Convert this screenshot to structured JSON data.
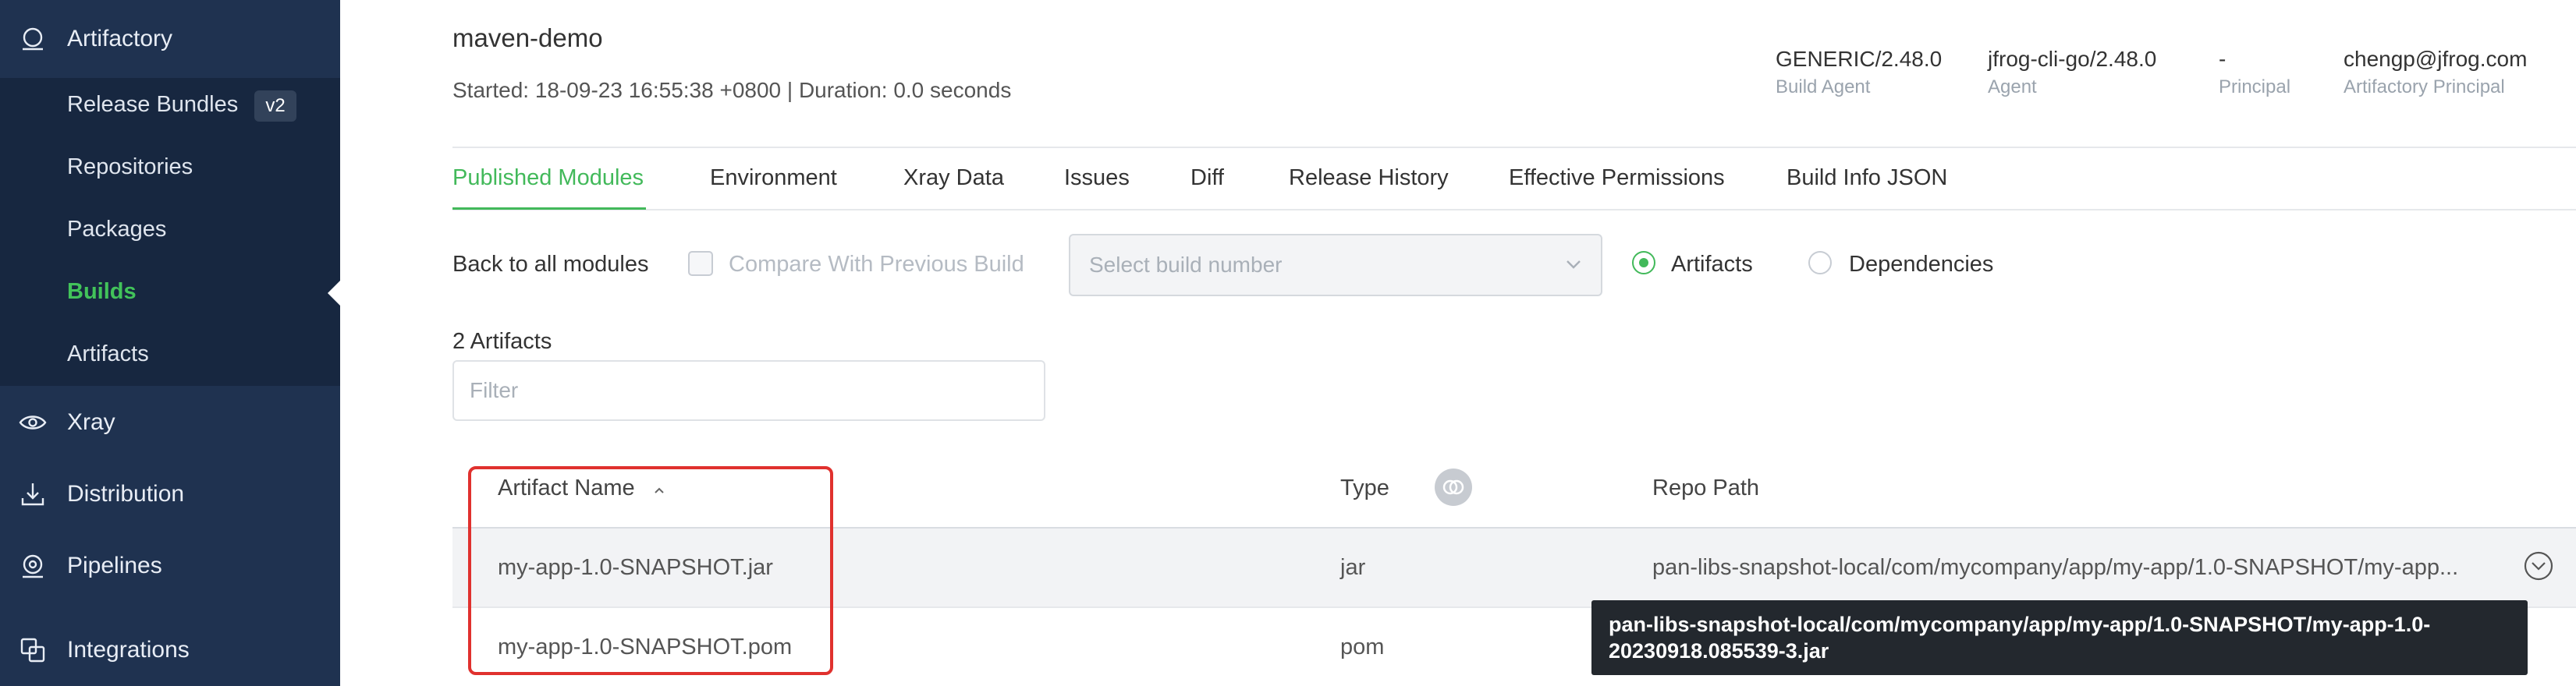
{
  "sidebar": {
    "main_items": [
      {
        "label": "Artifactory",
        "icon": "artifactory-icon"
      },
      {
        "label": "Xray",
        "icon": "eye-icon"
      },
      {
        "label": "Distribution",
        "icon": "download-icon"
      },
      {
        "label": "Pipelines",
        "icon": "pipelines-icon"
      },
      {
        "label": "Integrations",
        "icon": "integrations-icon"
      }
    ],
    "sub_items": [
      {
        "label": "Release Bundles",
        "badge": "v2"
      },
      {
        "label": "Repositories"
      },
      {
        "label": "Packages"
      },
      {
        "label": "Builds",
        "active": true
      },
      {
        "label": "Artifacts"
      }
    ]
  },
  "header": {
    "title": "maven-demo",
    "subtitle": "Started: 18-09-23 16:55:38 +0800 | Duration: 0.0 seconds",
    "meta": [
      {
        "value": "GENERIC/2.48.0",
        "key": "Build Agent"
      },
      {
        "value": "jfrog-cli-go/2.48.0",
        "key": "Agent"
      },
      {
        "value": "-",
        "key": "Principal"
      },
      {
        "value": "chengp@jfrog.com",
        "key": "Artifactory Principal"
      }
    ]
  },
  "tabs": [
    {
      "label": "Published Modules",
      "active": true
    },
    {
      "label": "Environment"
    },
    {
      "label": "Xray Data"
    },
    {
      "label": "Issues"
    },
    {
      "label": "Diff"
    },
    {
      "label": "Release History"
    },
    {
      "label": "Effective Permissions"
    },
    {
      "label": "Build Info JSON"
    }
  ],
  "controls": {
    "back_label": "Back to all modules",
    "compare_label": "Compare With Previous Build",
    "select_placeholder": "Select build number",
    "radio_artifacts": "Artifacts",
    "radio_dependencies": "Dependencies",
    "count_label": "2 Artifacts",
    "filter_placeholder": "Filter"
  },
  "table": {
    "columns": [
      "Artifact Name",
      "Type",
      "Repo Path"
    ],
    "rows": [
      {
        "name": "my-app-1.0-SNAPSHOT.jar",
        "type": "jar",
        "repo_path": "pan-libs-snapshot-local/com/mycompany/app/my-app/1.0-SNAPSHOT/my-app..."
      },
      {
        "name": "my-app-1.0-SNAPSHOT.pom",
        "type": "pom",
        "repo_path": ""
      }
    ],
    "tooltip_line1": "pan-libs-snapshot-local/com/mycompany/app/my-app/1.0-SNAPSHOT/my-app-1.0-",
    "tooltip_line2": "20230918.085539-3.jar"
  },
  "colors": {
    "sidebar_bg": "#1f3250",
    "accent_green": "#42b95a",
    "highlight_red": "#e0312e"
  }
}
